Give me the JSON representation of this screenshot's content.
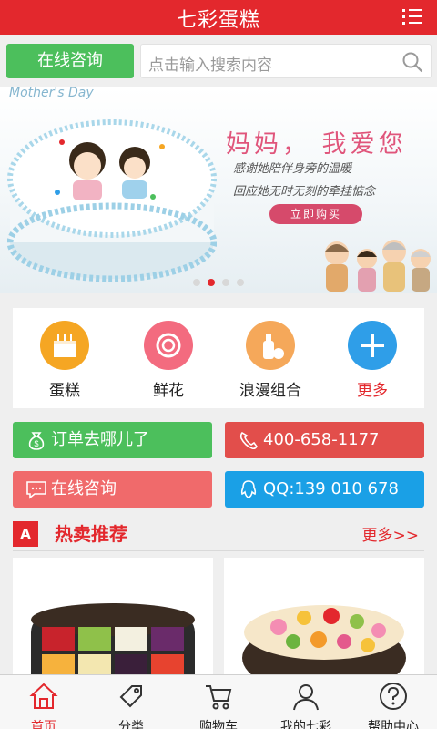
{
  "header": {
    "title": "七彩蛋糕",
    "menu_icon": "menu-icon"
  },
  "search": {
    "consult_label": "在线咨询",
    "placeholder": "点击输入搜索内容",
    "search_icon": "search-icon"
  },
  "banner": {
    "tag": "Mother's Day",
    "headline": "妈妈，  我爱您",
    "line1": "感谢她陪伴身旁的温暖",
    "line2": "回应她无时无刻的牵挂惦念",
    "cta": "立即购买",
    "slide_count": 4,
    "active_slide": 2
  },
  "categories": [
    {
      "label": "蛋糕",
      "icon": "cake-icon",
      "color": "#f5a623"
    },
    {
      "label": "鲜花",
      "icon": "flower-icon",
      "color": "#f36b7f"
    },
    {
      "label": "浪漫组合",
      "icon": "gift-bottle-icon",
      "color": "#f5a85a"
    },
    {
      "label": "更多",
      "icon": "plus-icon",
      "color": "#2f9ee8"
    }
  ],
  "quick_actions": [
    {
      "label": "订单去哪儿了",
      "icon": "money-bag-icon",
      "color": "#4cbf5c"
    },
    {
      "label": "400-658-1177",
      "icon": "phone-icon",
      "color": "#e24e4b"
    },
    {
      "label": "在线咨询",
      "icon": "chat-icon",
      "color": "#f06a6b"
    },
    {
      "label": "QQ:139 010 678",
      "icon": "qq-icon",
      "color": "#1aa0e6"
    }
  ],
  "hot": {
    "badge": "A",
    "title": "热卖推荐",
    "more": "更多>>"
  },
  "tabs": [
    {
      "label": "首页",
      "icon": "home-icon"
    },
    {
      "label": "分类",
      "icon": "tag-icon"
    },
    {
      "label": "购物车",
      "icon": "cart-icon"
    },
    {
      "label": "我的七彩",
      "icon": "user-icon"
    },
    {
      "label": "帮助中心",
      "icon": "help-icon"
    }
  ],
  "colors": {
    "brand": "#e3282d",
    "background": "#efefef"
  }
}
